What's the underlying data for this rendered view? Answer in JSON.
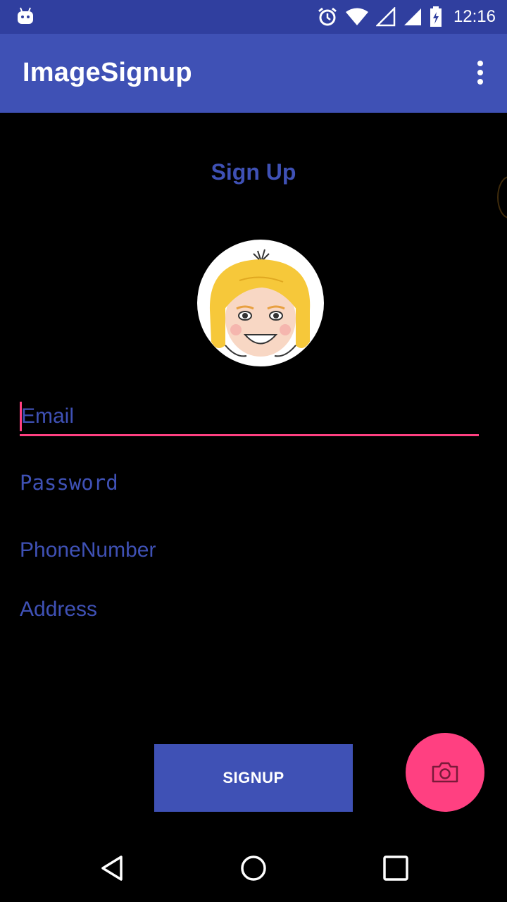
{
  "status_bar": {
    "time": "12:16",
    "icons": [
      "android-icon",
      "alarm-icon",
      "wifi-icon",
      "signal-empty-icon",
      "signal-icon",
      "battery-icon"
    ]
  },
  "app_bar": {
    "title": "ImageSignup",
    "overflow_icon": "more-vert-icon"
  },
  "form": {
    "heading": "Sign Up",
    "avatar_icon": "cartoon-avatar",
    "email_placeholder": "Email",
    "password_placeholder": "Password",
    "phone_placeholder": "PhoneNumber",
    "address_placeholder": "Address",
    "signup_label": "SIGNUP",
    "fab_icon": "camera-icon"
  },
  "nav_bar": {
    "icons": [
      "back-icon",
      "home-icon",
      "recents-icon"
    ]
  },
  "colors": {
    "primary": "#3F51B5",
    "primary_dark": "#303F9F",
    "accent": "#FF4081",
    "background": "#000000"
  }
}
